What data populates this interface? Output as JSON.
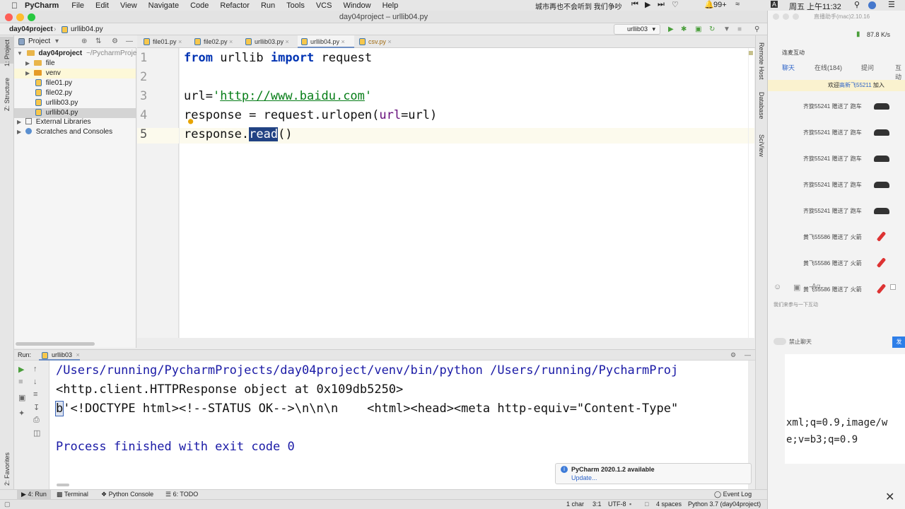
{
  "menubar": {
    "app": "PyCharm",
    "items": [
      "File",
      "Edit",
      "View",
      "Navigate",
      "Code",
      "Refactor",
      "Run",
      "Tools",
      "VCS",
      "Window",
      "Help"
    ],
    "status_text": "城市再也不会听到 我们争吵",
    "badge": "99+",
    "datetime": "周五 上午11:32"
  },
  "window": {
    "title": "day04project – urllib04.py"
  },
  "navbar": {
    "project": "day04project",
    "file": "urllib04.py",
    "run_config": "urllib03"
  },
  "project_panel": {
    "title": "Project",
    "root": "day04project",
    "root_path": "~/PycharmProje",
    "items": [
      "file",
      "venv",
      "file01.py",
      "file02.py",
      "urllib03.py",
      "urllib04.py"
    ],
    "external": "External Libraries",
    "scratches": "Scratches and Consoles"
  },
  "left_stripe": {
    "project": "1: Project",
    "structure": "Z: Structure",
    "favorites": "2: Favorites"
  },
  "right_stripe": {
    "remote": "Remote Host",
    "database": "Database",
    "sciview": "SciView"
  },
  "tabs": [
    "file01.py",
    "file02.py",
    "urllib03.py",
    "urllib04.py",
    "csv.py"
  ],
  "editor": {
    "line_numbers": [
      "1",
      "2",
      "3",
      "4",
      "5"
    ],
    "l1_kw1": "from",
    "l1_mod": " urllib ",
    "l1_kw2": "import",
    "l1_rest": " request",
    "l3_pre": "url=",
    "l3_q1": "'",
    "l3_url": "http://www.baidu.com",
    "l3_q2": "'",
    "l4_pre": "response = request.urlopen(",
    "l4_param": "url",
    "l4_post": "=url)",
    "l5_pre": "response.",
    "l5_sel": "read",
    "l5_post": "()"
  },
  "run": {
    "label": "Run:",
    "config": "urllib03",
    "lines": [
      "/Users/running/PycharmProjects/day04project/venv/bin/python /Users/running/PycharmProj",
      "<http.client.HTTPResponse object at 0x109db5250>",
      "'<!DOCTYPE html><!--STATUS OK-->\\n\\n\\n    <html><head><meta http-equiv=\"Content-Type\"",
      "Process finished with exit code 0"
    ],
    "prefix_b": "b"
  },
  "notification": {
    "title": "PyCharm 2020.1.2 available",
    "link": "Update..."
  },
  "bottom_tabs": [
    "4: Run",
    "Terminal",
    "Python Console",
    "6: TODO"
  ],
  "event_log": "Event Log",
  "status": {
    "left": "1 char",
    "pos": "3:1",
    "encoding": "UTF-8",
    "indent": "4 spaces",
    "interpreter": "Python 3.7 (day04project)"
  },
  "live": {
    "title": "直播助手(mac)2.10.16",
    "speed": "87.8 K/s",
    "connected": "连麦互动",
    "tabs": [
      "聊天",
      "在线(184)",
      "提问",
      "互动"
    ],
    "join_pre": "欢迎",
    "join_name": "高新飞55211",
    "join_post": "加入",
    "gifts": [
      {
        "text": "齐旋55241 赠送了 跑车",
        "icon": "car"
      },
      {
        "text": "齐旋55241 赠送了 跑车",
        "icon": "car"
      },
      {
        "text": "齐旋55241 赠送了 跑车",
        "icon": "car"
      },
      {
        "text": "齐旋55241 赠送了 跑车",
        "icon": "car"
      },
      {
        "text": "齐旋55241 赠送了 跑车",
        "icon": "car"
      },
      {
        "text": "黄飞55586 赠送了 火箭",
        "icon": "rocket"
      },
      {
        "text": "黄飞55586 赠送了 火箭",
        "icon": "rocket"
      },
      {
        "text": "黄飞55586 赠送了 火箭",
        "icon": "rocket"
      }
    ],
    "input_placeholder": "我们来参与一下互动",
    "mute": "禁止聊天",
    "send": "发",
    "bg_line1": "xml;q=0.9,image/w",
    "bg_line2": "e;v=b3;q=0.9"
  }
}
